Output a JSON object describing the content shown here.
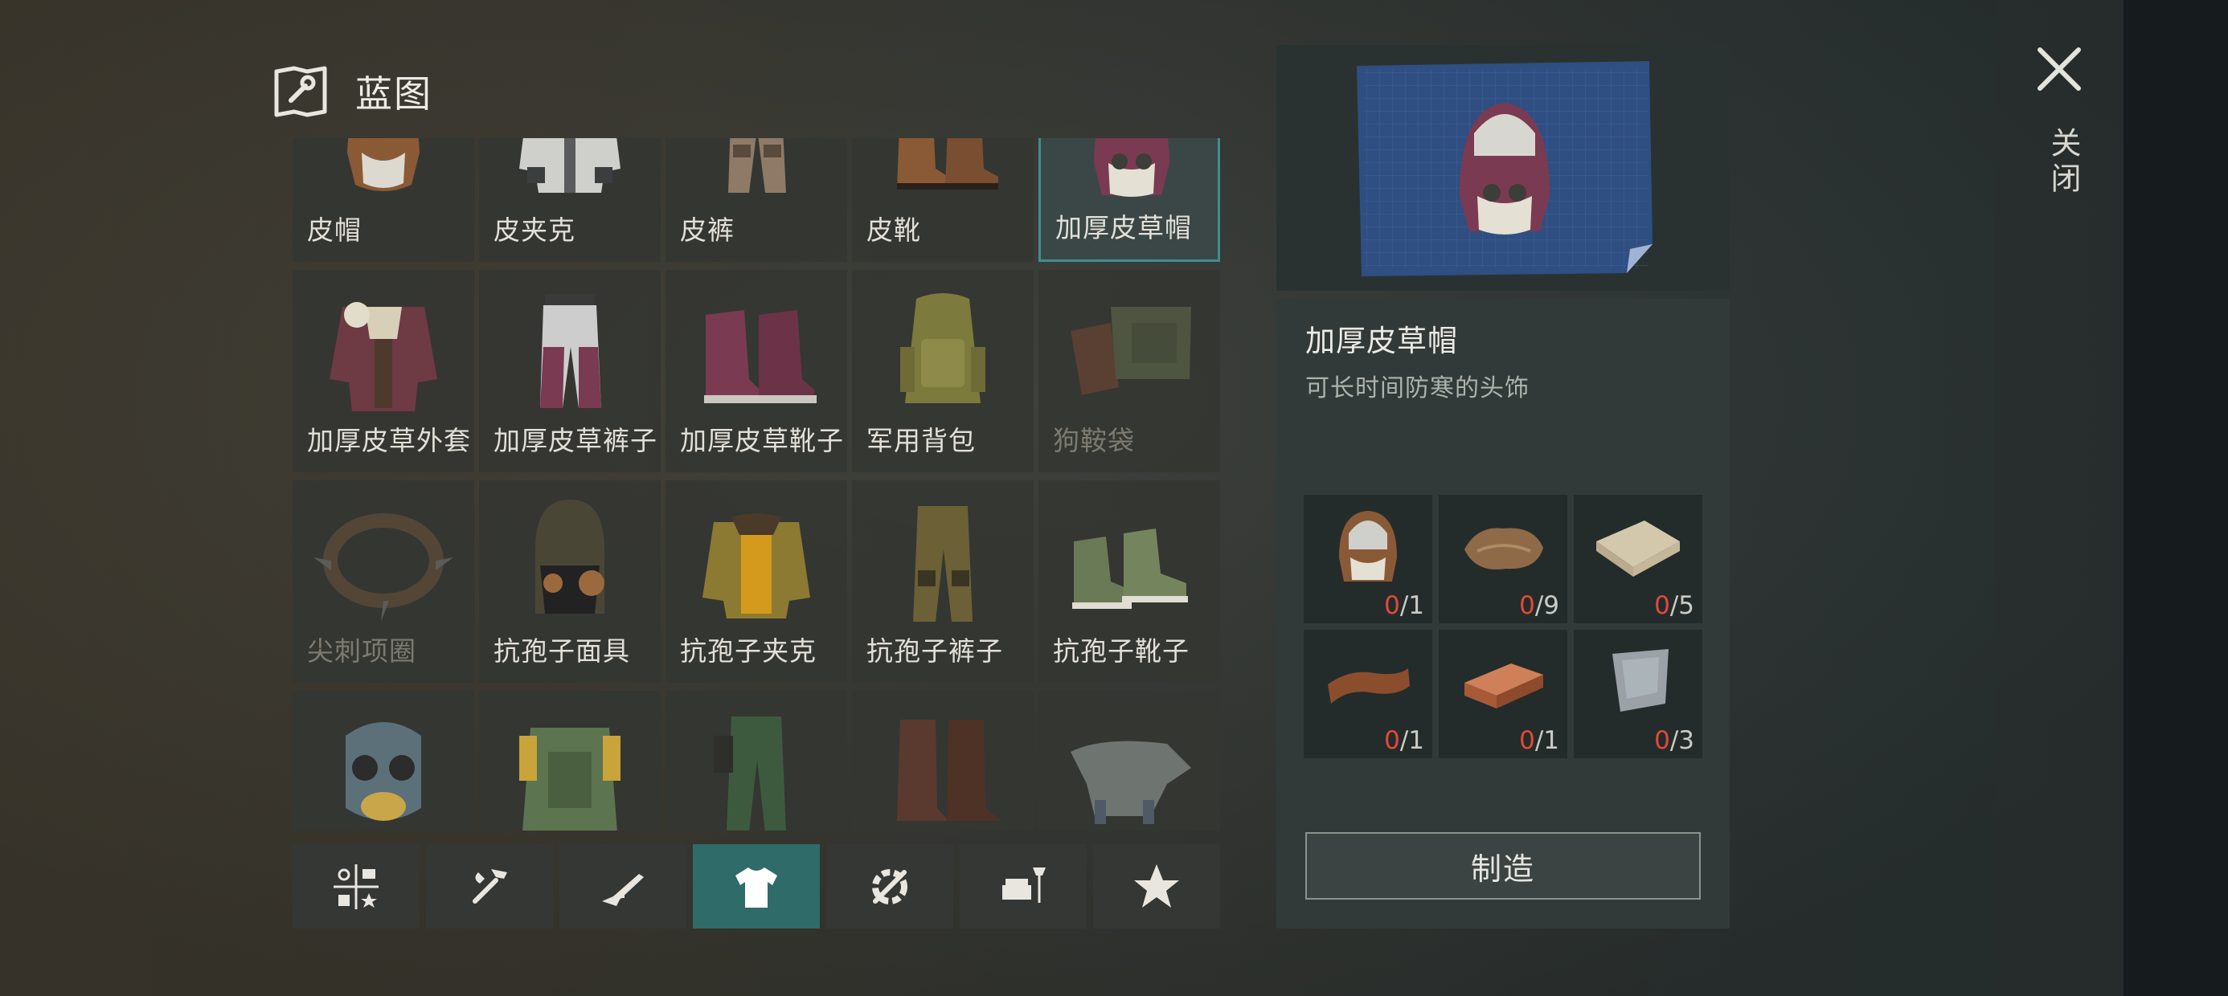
{
  "header": {
    "title": "蓝图"
  },
  "grid": {
    "items": [
      {
        "name": "皮帽",
        "icon": "leather-hat-icon"
      },
      {
        "name": "皮夹克",
        "icon": "leather-jacket-icon"
      },
      {
        "name": "皮裤",
        "icon": "leather-pants-icon"
      },
      {
        "name": "皮靴",
        "icon": "leather-boots-icon"
      },
      {
        "name": "加厚皮草帽",
        "icon": "fur-hat-icon",
        "selected": true
      },
      {
        "name": "加厚皮草外套",
        "icon": "fur-coat-icon"
      },
      {
        "name": "加厚皮草裤子",
        "icon": "fur-pants-icon"
      },
      {
        "name": "加厚皮草靴子",
        "icon": "fur-boots-icon"
      },
      {
        "name": "军用背包",
        "icon": "military-backpack-icon"
      },
      {
        "name": "狗鞍袋",
        "icon": "dog-saddlebag-icon",
        "disabled": true
      },
      {
        "name": "尖刺项圈",
        "icon": "spiked-collar-icon",
        "disabled": true
      },
      {
        "name": "抗孢子面具",
        "icon": "spore-mask-icon"
      },
      {
        "name": "抗孢子夹克",
        "icon": "spore-jacket-icon"
      },
      {
        "name": "抗孢子裤子",
        "icon": "spore-pants-icon"
      },
      {
        "name": "抗孢子靴子",
        "icon": "spore-boots-icon"
      },
      {
        "name": "",
        "icon": "gas-mask-icon"
      },
      {
        "name": "",
        "icon": "armored-vest-icon"
      },
      {
        "name": "",
        "icon": "camo-pants-icon"
      },
      {
        "name": "",
        "icon": "tall-boots-icon"
      },
      {
        "name": "",
        "icon": "dog-armor-icon"
      }
    ]
  },
  "tabs": [
    {
      "icon": "all-categories-icon"
    },
    {
      "icon": "tools-icon"
    },
    {
      "icon": "weapons-icon"
    },
    {
      "icon": "clothing-icon",
      "active": true
    },
    {
      "icon": "components-icon"
    },
    {
      "icon": "furniture-icon"
    },
    {
      "icon": "favorites-star-icon"
    }
  ],
  "detail": {
    "name": "加厚皮草帽",
    "description": "可长时间防寒的头饰",
    "materials": [
      {
        "icon": "leather-hat-icon",
        "have": "0",
        "need": "/1"
      },
      {
        "icon": "fur-pelt-icon",
        "have": "0",
        "need": "/9"
      },
      {
        "icon": "fabric-icon",
        "have": "0",
        "need": "/5"
      },
      {
        "icon": "leather-strip-icon",
        "have": "0",
        "need": "/1"
      },
      {
        "icon": "copper-bar-icon",
        "have": "0",
        "need": "/1"
      },
      {
        "icon": "sheet-metal-icon",
        "have": "0",
        "need": "/3"
      }
    ],
    "craft_label": "制造"
  },
  "close": {
    "label": "关闭"
  },
  "colors": {
    "accent": "#2f6b68",
    "missing": "#e04a3a",
    "selected_border": "#3f8f8c"
  }
}
